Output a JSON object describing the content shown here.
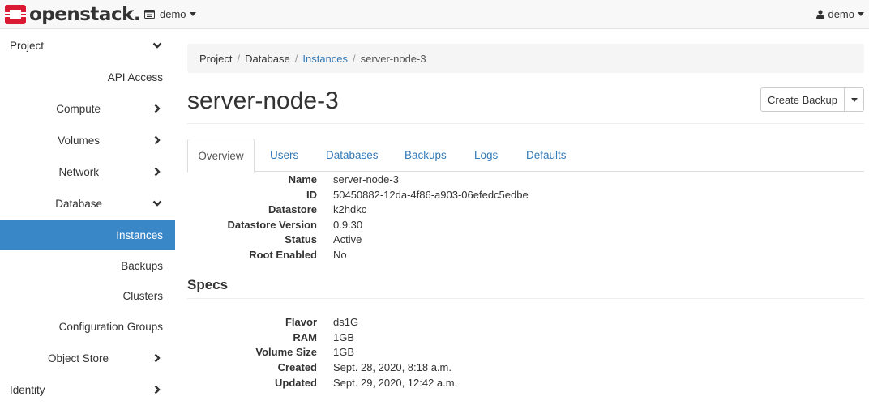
{
  "brand": {
    "name": "openstack."
  },
  "navbar": {
    "project": "demo",
    "user": "demo",
    "project_icon": "project-box-icon",
    "user_icon": "user-icon"
  },
  "colors": {
    "accent": "#337ab7",
    "active_nav": "#3a87c8",
    "logo_red": "#da1a32"
  },
  "sidebar": {
    "items": [
      {
        "label": "Project",
        "icon": "chevron-down-icon"
      },
      {
        "label": "API Access"
      },
      {
        "label": "Compute",
        "icon": "chevron-right-icon"
      },
      {
        "label": "Volumes",
        "icon": "chevron-right-icon"
      },
      {
        "label": "Network",
        "icon": "chevron-right-icon"
      },
      {
        "label": "Database",
        "icon": "chevron-down-icon"
      },
      {
        "label": "Instances",
        "active": true
      },
      {
        "label": "Backups"
      },
      {
        "label": "Clusters"
      },
      {
        "label": "Configuration Groups"
      },
      {
        "label": "Object Store",
        "icon": "chevron-right-icon"
      },
      {
        "label": "Identity",
        "icon": "chevron-right-icon"
      }
    ]
  },
  "breadcrumb": {
    "items": [
      "Project",
      "Database",
      "Instances",
      "server-node-3"
    ]
  },
  "page": {
    "title": "server-node-3",
    "create_backup": "Create Backup"
  },
  "tabs": [
    "Overview",
    "Users",
    "Databases",
    "Backups",
    "Logs",
    "Defaults"
  ],
  "overview": {
    "rows": [
      {
        "key": "Name",
        "value": "server-node-3"
      },
      {
        "key": "ID",
        "value": "50450882-12da-4f86-a903-06efedc5edbe"
      },
      {
        "key": "Datastore",
        "value": "k2hdkc"
      },
      {
        "key": "Datastore Version",
        "value": "0.9.30"
      },
      {
        "key": "Status",
        "value": "Active"
      },
      {
        "key": "Root Enabled",
        "value": "No"
      }
    ]
  },
  "specs": {
    "heading": "Specs",
    "rows": [
      {
        "key": "Flavor",
        "value": "ds1G"
      },
      {
        "key": "RAM",
        "value": "1GB"
      },
      {
        "key": "Volume Size",
        "value": "1GB"
      },
      {
        "key": "Created",
        "value": "Sept. 28, 2020, 8:18 a.m."
      },
      {
        "key": "Updated",
        "value": "Sept. 29, 2020, 12:42 a.m."
      }
    ]
  }
}
